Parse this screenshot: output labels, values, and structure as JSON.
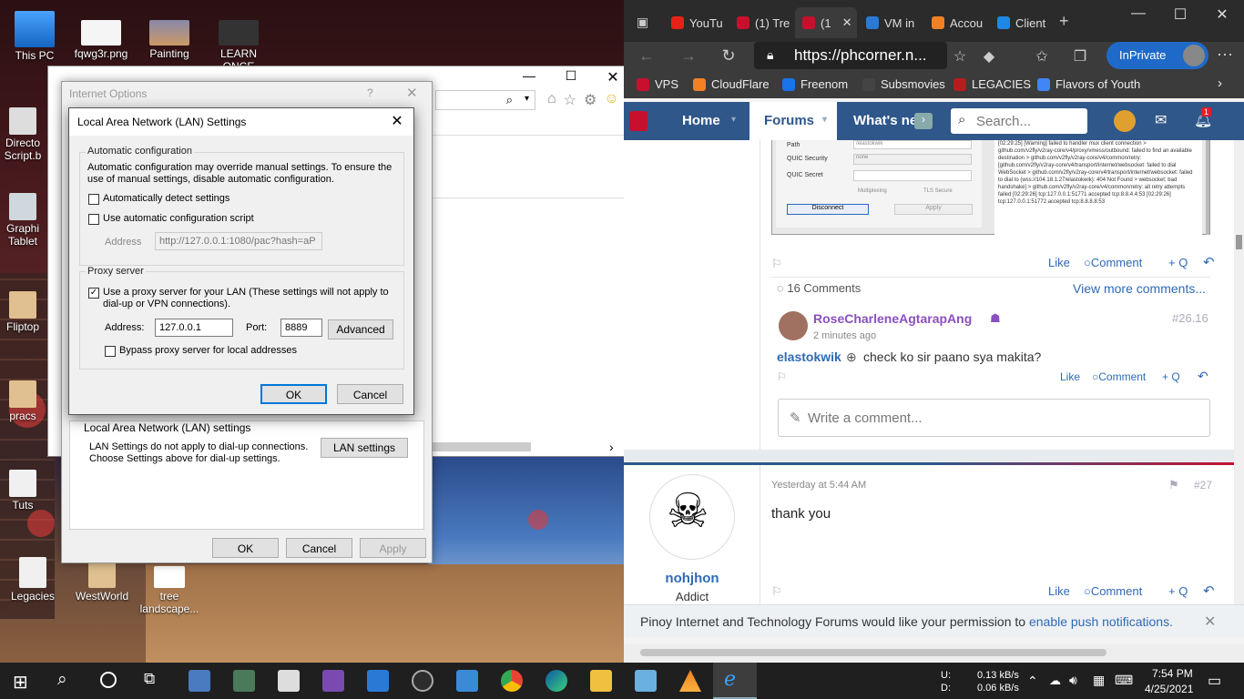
{
  "desktop": {
    "icons": [
      {
        "label": "This PC"
      },
      {
        "label": "fqwg3r.png"
      },
      {
        "label": "Painting"
      },
      {
        "label": "LEARN ONCE"
      },
      {
        "label": "Directo Script.b"
      },
      {
        "label": "Graphi Tablet"
      },
      {
        "label": "Fliptop"
      },
      {
        "label": "pracs"
      },
      {
        "label": "Tuts"
      },
      {
        "label": "Legacies"
      },
      {
        "label": "WestWorld"
      },
      {
        "label": "tree landscape..."
      }
    ]
  },
  "internet_options": {
    "title": "Internet Options",
    "help": "?",
    "lan_section_label": "Local Area Network (LAN) settings",
    "lan_note": "LAN Settings do not apply to dial-up connections. Choose Settings above for dial-up settings.",
    "lan_settings_button": "LAN settings",
    "ok": "OK",
    "cancel": "Cancel",
    "apply": "Apply"
  },
  "lan_dialog": {
    "title": "Local Area Network (LAN) Settings",
    "auto_config_label": "Automatic configuration",
    "auto_config_desc": "Automatic configuration may override manual settings.  To ensure the use of manual settings, disable automatic configuration.",
    "auto_detect_label": "Automatically detect settings",
    "auto_detect_checked": false,
    "auto_script_label": "Use automatic configuration script",
    "auto_script_checked": false,
    "address_label": "Address",
    "script_address": "http://127.0.0.1:1080/pac?hash=aP",
    "proxy_label": "Proxy server",
    "use_proxy_label": "Use a proxy server for your LAN (These settings will not apply to dial-up or VPN connections).",
    "use_proxy_checked": true,
    "proxy_address_label": "Address:",
    "proxy_address": "127.0.0.1",
    "port_label": "Port:",
    "port": "8889",
    "advanced": "Advanced",
    "bypass_label": "Bypass proxy server for local addresses",
    "bypass_checked": false,
    "ok": "OK",
    "cancel": "Cancel"
  },
  "browser": {
    "tabs": [
      {
        "label": "YouTu",
        "color": "#e62117"
      },
      {
        "label": "(1) Tre",
        "color": "#c8102e"
      },
      {
        "label": "(1",
        "color": "#c8102e",
        "active": true
      },
      {
        "label": "VM in",
        "color": "#2a7ad5"
      },
      {
        "label": "Accou",
        "color": "#f48024"
      },
      {
        "label": "Client",
        "color": "#1e88e5"
      }
    ],
    "url": "https://phcorner.n...",
    "inprivate": "InPrivate",
    "favorites": [
      {
        "label": "VPS",
        "color": "#c8102e"
      },
      {
        "label": "CloudFlare",
        "color": "#f48024"
      },
      {
        "label": "Freenom",
        "color": "#1a73e8"
      },
      {
        "label": "Subsmovies",
        "color": "#444"
      },
      {
        "label": "LEGACIES",
        "color": "#b71c1c"
      },
      {
        "label": "Flavors of Youth",
        "color": "#4285f4"
      }
    ],
    "site_nav": {
      "home": "Home",
      "forums": "Forums",
      "whats_new": "What's ne",
      "search_placeholder": "Search...",
      "alerts_count": "1"
    },
    "screenshot_text": {
      "path": "Path",
      "path_value": "/elastokwik",
      "quic_security": "QUIC Security",
      "quic_security_value": "none",
      "quic_secret": "QUIC Secret",
      "multiplexing": "Multiplexing",
      "tls_secure": "TLS Secure",
      "disconnect": "Disconnect",
      "apply": "Apply",
      "log": "[02:29:25] [Warning] failed to handler mux client connection > github.com/v2fly/v2ray-core/v4/proxy/vmess/outbound: failed to find an available destination > github.com/v2fly/v2ray-core/v4/common/retry: [github.com/v2fly/v2ray-core/v4/transport/internet/websocket: failed to dial WebSocket > github.com/v2fly/v2ray-core/v4/transport/internet/websocket: failed to dial to (wss://104.18.1.27/elastokwik): 404 Not Found > websocket: bad handshake] > github.com/v2fly/v2ray-core/v4/common/retry: all retry attempts failed [02:29:26] tcp:127.0.0.1:51771 accepted tcp:8.8.4.4:53 [02:29:26] tcp:127.0.0.1:51772 accepted tcp:8.8.8.8:53"
    },
    "post_actions": {
      "like": "Like",
      "comment": "Comment",
      "quote": "+ Q"
    },
    "comments_count": "16 Comments",
    "view_more": "View more comments...",
    "comment": {
      "author": "RoseCharleneAgtarapAng",
      "time": "2 minutes ago",
      "number": "#26.16",
      "mention": "elastokwik",
      "text": "check ko sir paano sya makita?"
    },
    "write_comment": "Write a comment...",
    "post27": {
      "date": "Yesterday at 5:44 AM",
      "number": "#27",
      "text": "thank you",
      "author": "nohjhon",
      "role": "Addict"
    },
    "notify_text": "Pinoy Internet and Technology Forums would like your permission to ",
    "notify_link": "enable push notifications."
  },
  "taskbar": {
    "upload_label": "U:",
    "download_label": "D:",
    "upload": "0.13 kB/s",
    "download": "0.06 kB/s",
    "time": "7:54 PM",
    "date": "4/25/2021"
  }
}
